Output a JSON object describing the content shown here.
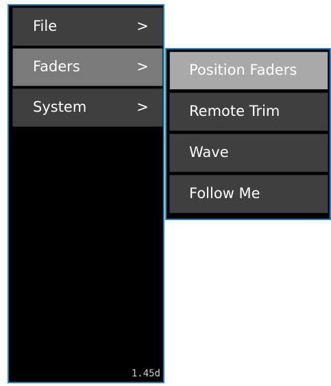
{
  "main_menu": {
    "items": [
      {
        "label": "File",
        "arrow": ">"
      },
      {
        "label": "Faders",
        "arrow": ">"
      },
      {
        "label": "System",
        "arrow": ">"
      }
    ],
    "selected": "Faders",
    "version": "1.45d"
  },
  "sub_menu": {
    "items": [
      {
        "label": "Position Faders"
      },
      {
        "label": "Remote Trim"
      },
      {
        "label": "Wave"
      },
      {
        "label": "Follow Me"
      }
    ],
    "selected": "Position Faders"
  },
  "colors": {
    "border": "#1f86c6",
    "panel_bg": "#000000",
    "item_bg": "#3f3f3f",
    "main_selected_bg": "#7a7a7a",
    "sub_selected_bg": "#a9a9a9"
  }
}
